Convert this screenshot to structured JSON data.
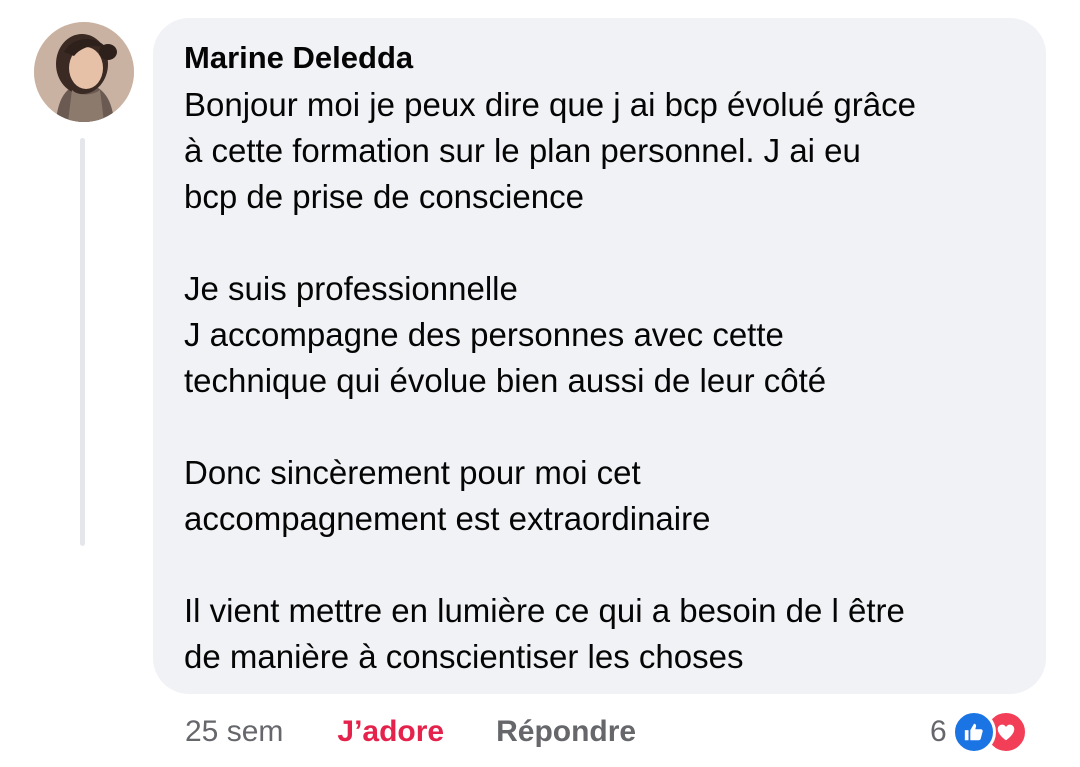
{
  "comment": {
    "author": "Marine Deledda",
    "paragraphs": [
      [
        "Bonjour moi je peux dire que j ai bcp évolué grâce",
        "à cette formation sur le plan personnel.  J ai eu",
        "bcp de prise de conscience"
      ],
      [
        "Je suis professionnelle",
        "J accompagne des personnes avec cette",
        "technique qui évolue bien aussi de leur côté"
      ],
      [
        "Donc sincèrement pour moi cet",
        "accompagnement est extraordinaire"
      ],
      [
        "Il vient mettre en lumière ce qui a besoin de l être",
        "de manière à conscientiser les choses"
      ]
    ]
  },
  "actions": {
    "time": "25 sem",
    "reaction_label": "J’adore",
    "reply_label": "Répondre"
  },
  "reactions": {
    "count": "6",
    "icons": [
      "like-icon",
      "heart-icon"
    ]
  },
  "colors": {
    "bubble": "#f0f2f5",
    "love": "#e4224b",
    "like": "#1b74e4",
    "heart": "#f33e58"
  }
}
